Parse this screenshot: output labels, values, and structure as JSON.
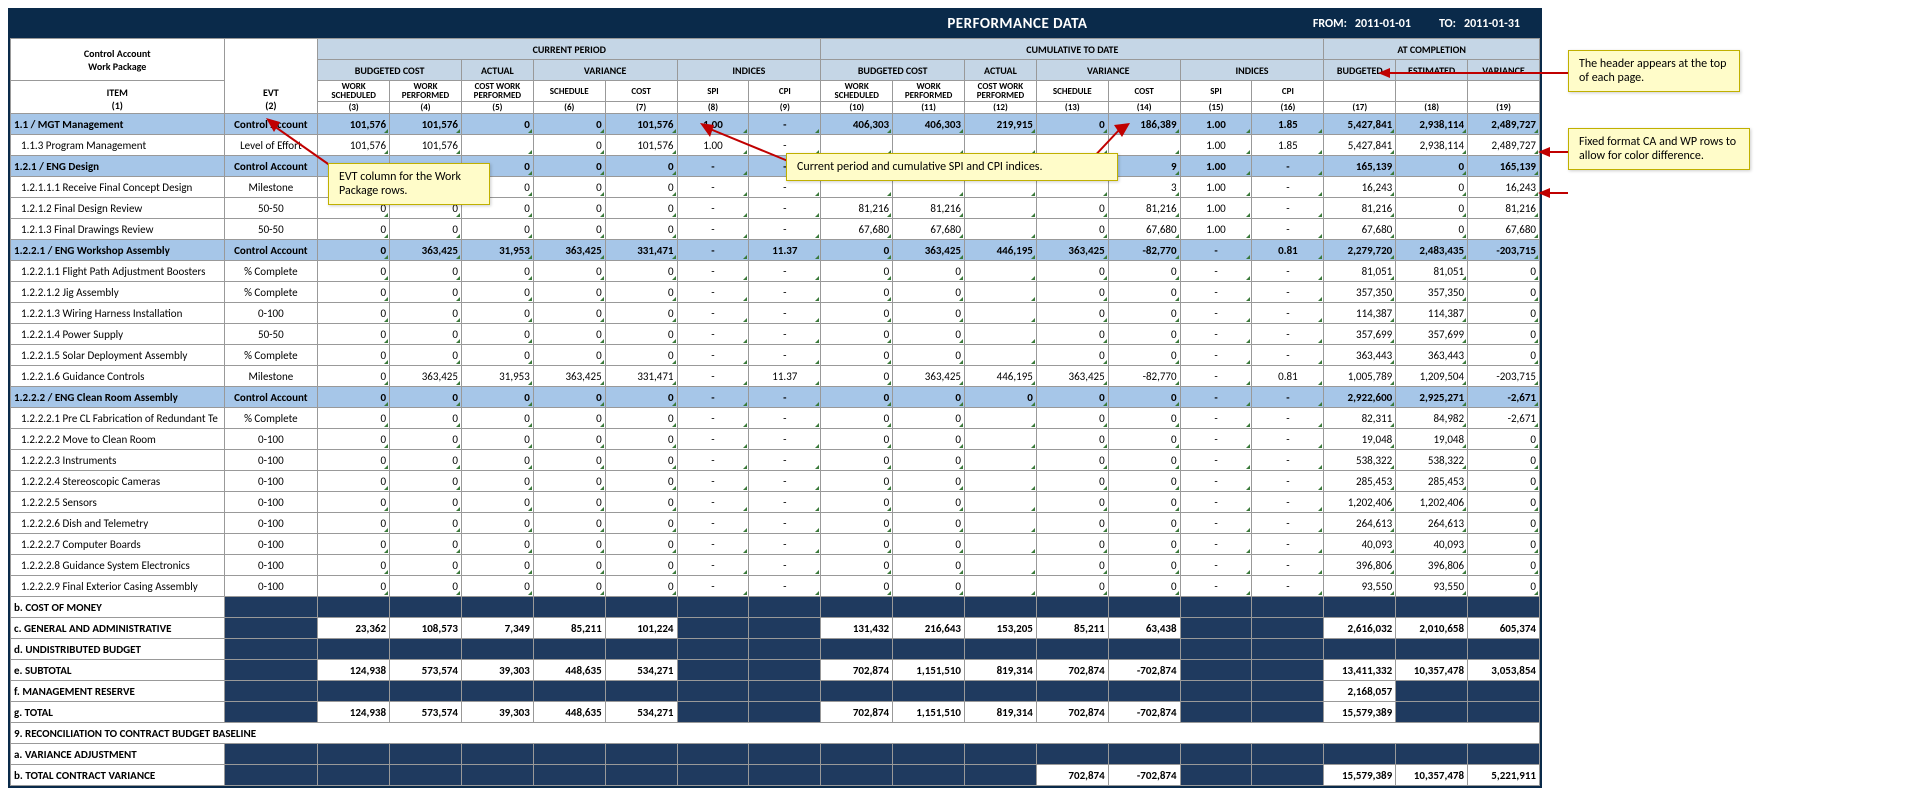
{
  "header": {
    "title": "PERFORMANCE DATA",
    "from_label": "FROM:",
    "from_date": "2011-01-01",
    "to_label": "TO:",
    "to_date": "2011-01-31"
  },
  "col_headers": {
    "ca": "Control Account",
    "wp": "Work Package",
    "item": "ITEM",
    "evt": "EVT",
    "current_period": "CURRENT PERIOD",
    "cumulative": "CUMULATIVE TO DATE",
    "at_completion": "AT COMPLETION",
    "budgeted_cost": "BUDGETED COST",
    "actual": "ACTUAL",
    "variance": "VARIANCE",
    "indices": "INDICES",
    "budgeted": "BUDGETED",
    "estimated": "ESTIMATED",
    "variance2": "VARIANCE",
    "work_scheduled": "WORK SCHEDULED",
    "work_performed": "WORK PERFORMED",
    "cost_work_performed": "COST WORK PERFORMED",
    "schedule": "SCHEDULE",
    "cost": "COST",
    "spi": "SPI",
    "cpi": "CPI",
    "n1": "(1)",
    "n2": "(2)",
    "n3": "(3)",
    "n4": "(4)",
    "n5": "(5)",
    "n6": "(6)",
    "n7": "(7)",
    "n8": "(8)",
    "n9": "(9)",
    "n10": "(10)",
    "n11": "(11)",
    "n12": "(12)",
    "n13": "(13)",
    "n14": "(14)",
    "n15": "(15)",
    "n16": "(16)",
    "n17": "(17)",
    "n18": "(18)",
    "n19": "(19)"
  },
  "rows": [
    {
      "cls": "ca",
      "item": "1.1 / MGT Management",
      "evt": "Control Account",
      "c": [
        "101,576",
        "101,576",
        "0",
        "0",
        "101,576",
        "1.00",
        "-",
        "406,303",
        "406,303",
        "219,915",
        "0",
        "186,389",
        "1.00",
        "1.85",
        "5,427,841",
        "2,938,114",
        "2,489,727"
      ]
    },
    {
      "cls": "wp",
      "item": "1.1.3 Program Management",
      "evt": "Level of Effort",
      "c": [
        "101,576",
        "101,576",
        "",
        "0",
        "101,576",
        "1.00",
        "-",
        "",
        "",
        "",
        "",
        "",
        "1.00",
        "1.85",
        "5,427,841",
        "2,938,114",
        "2,489,727"
      ]
    },
    {
      "cls": "ca",
      "item": "1.2.1 / ENG Design",
      "evt": "Control Account",
      "c": [
        "0",
        "0",
        "0",
        "0",
        "0",
        "-",
        "-",
        "",
        "",
        "",
        "",
        "9",
        "1.00",
        "-",
        "165,139",
        "0",
        "165,139"
      ]
    },
    {
      "cls": "wp",
      "item": "1.2.1.1.1 Receive Final Concept Design",
      "evt": "Milestone",
      "c": [
        "0",
        "",
        "0",
        "0",
        "0",
        "-",
        "-",
        "",
        "",
        "",
        "",
        "3",
        "1.00",
        "-",
        "16,243",
        "0",
        "16,243"
      ]
    },
    {
      "cls": "wp",
      "item": "1.2.1.2 Final Design Review",
      "evt": "50-50",
      "c": [
        "0",
        "0",
        "0",
        "0",
        "0",
        "-",
        "-",
        "81,216",
        "81,216",
        "",
        "0",
        "81,216",
        "1.00",
        "-",
        "81,216",
        "0",
        "81,216"
      ]
    },
    {
      "cls": "wp",
      "item": "1.2.1.3 Final Drawings Review",
      "evt": "50-50",
      "c": [
        "0",
        "0",
        "0",
        "0",
        "0",
        "-",
        "-",
        "67,680",
        "67,680",
        "",
        "0",
        "67,680",
        "1.00",
        "-",
        "67,680",
        "0",
        "67,680"
      ]
    },
    {
      "cls": "ca",
      "item": "1.2.2.1 / ENG Workshop Assembly",
      "evt": "Control Account",
      "c": [
        "0",
        "363,425",
        "31,953",
        "363,425",
        "331,471",
        "-",
        "11.37",
        "0",
        "363,425",
        "446,195",
        "363,425",
        "-82,770",
        "-",
        "0.81",
        "2,279,720",
        "2,483,435",
        "-203,715"
      ]
    },
    {
      "cls": "wp",
      "item": "1.2.2.1.1 Flight Path Adjustment Boosters",
      "evt": "% Complete",
      "c": [
        "0",
        "0",
        "0",
        "0",
        "0",
        "-",
        "-",
        "0",
        "0",
        "",
        "0",
        "0",
        "-",
        "-",
        "81,051",
        "81,051",
        "0"
      ]
    },
    {
      "cls": "wp",
      "item": "1.2.2.1.2 Jig Assembly",
      "evt": "% Complete",
      "c": [
        "0",
        "0",
        "0",
        "0",
        "0",
        "-",
        "-",
        "0",
        "0",
        "",
        "0",
        "0",
        "-",
        "-",
        "357,350",
        "357,350",
        "0"
      ]
    },
    {
      "cls": "wp",
      "item": "1.2.2.1.3 Wiring Harness Installation",
      "evt": "0-100",
      "c": [
        "0",
        "0",
        "0",
        "0",
        "0",
        "-",
        "-",
        "0",
        "0",
        "",
        "0",
        "0",
        "-",
        "-",
        "114,387",
        "114,387",
        "0"
      ]
    },
    {
      "cls": "wp",
      "item": "1.2.2.1.4 Power Supply",
      "evt": "50-50",
      "c": [
        "0",
        "0",
        "0",
        "0",
        "0",
        "-",
        "-",
        "0",
        "0",
        "",
        "0",
        "0",
        "-",
        "-",
        "357,699",
        "357,699",
        "0"
      ]
    },
    {
      "cls": "wp",
      "item": "1.2.2.1.5 Solar Deployment Assembly",
      "evt": "% Complete",
      "c": [
        "0",
        "0",
        "0",
        "0",
        "0",
        "-",
        "-",
        "0",
        "0",
        "",
        "0",
        "0",
        "-",
        "-",
        "363,443",
        "363,443",
        "0"
      ]
    },
    {
      "cls": "wp",
      "item": "1.2.2.1.6 Guidance Controls",
      "evt": "Milestone",
      "c": [
        "0",
        "363,425",
        "31,953",
        "363,425",
        "331,471",
        "-",
        "11.37",
        "0",
        "363,425",
        "446,195",
        "363,425",
        "-82,770",
        "-",
        "0.81",
        "1,005,789",
        "1,209,504",
        "-203,715"
      ]
    },
    {
      "cls": "ca",
      "item": "1.2.2.2 / ENG Clean Room Assembly",
      "evt": "Control Account",
      "c": [
        "0",
        "0",
        "0",
        "0",
        "0",
        "-",
        "-",
        "0",
        "0",
        "0",
        "0",
        "0",
        "-",
        "-",
        "2,922,600",
        "2,925,271",
        "-2,671"
      ]
    },
    {
      "cls": "wp",
      "item": "1.2.2.2.1 Pre CL Fabrication of Redundant Te",
      "evt": "% Complete",
      "c": [
        "0",
        "0",
        "0",
        "0",
        "0",
        "-",
        "-",
        "0",
        "0",
        "",
        "0",
        "0",
        "-",
        "-",
        "82,311",
        "84,982",
        "-2,671"
      ]
    },
    {
      "cls": "wp",
      "item": "1.2.2.2.2 Move to Clean Room",
      "evt": "0-100",
      "c": [
        "0",
        "0",
        "0",
        "0",
        "0",
        "-",
        "-",
        "0",
        "0",
        "",
        "0",
        "0",
        "-",
        "-",
        "19,048",
        "19,048",
        "0"
      ]
    },
    {
      "cls": "wp",
      "item": "1.2.2.2.3 Instruments",
      "evt": "0-100",
      "c": [
        "0",
        "0",
        "0",
        "0",
        "0",
        "-",
        "-",
        "0",
        "0",
        "",
        "0",
        "0",
        "-",
        "-",
        "538,322",
        "538,322",
        "0"
      ]
    },
    {
      "cls": "wp",
      "item": "1.2.2.2.4 Stereoscopic Cameras",
      "evt": "0-100",
      "c": [
        "0",
        "0",
        "0",
        "0",
        "0",
        "-",
        "-",
        "0",
        "0",
        "",
        "0",
        "0",
        "-",
        "-",
        "285,453",
        "285,453",
        "0"
      ]
    },
    {
      "cls": "wp",
      "item": "1.2.2.2.5 Sensors",
      "evt": "0-100",
      "c": [
        "0",
        "0",
        "0",
        "0",
        "0",
        "-",
        "-",
        "0",
        "0",
        "",
        "0",
        "0",
        "-",
        "-",
        "1,202,406",
        "1,202,406",
        "0"
      ]
    },
    {
      "cls": "wp",
      "item": "1.2.2.2.6 Dish and Telemetry",
      "evt": "0-100",
      "c": [
        "0",
        "0",
        "0",
        "0",
        "0",
        "-",
        "-",
        "0",
        "0",
        "",
        "0",
        "0",
        "-",
        "-",
        "264,613",
        "264,613",
        "0"
      ]
    },
    {
      "cls": "wp",
      "item": "1.2.2.2.7 Computer Boards",
      "evt": "0-100",
      "c": [
        "0",
        "0",
        "0",
        "0",
        "0",
        "-",
        "-",
        "0",
        "0",
        "",
        "0",
        "0",
        "-",
        "-",
        "40,093",
        "40,093",
        "0"
      ]
    },
    {
      "cls": "wp",
      "item": "1.2.2.2.8 Guidance System Electronics",
      "evt": "0-100",
      "c": [
        "0",
        "0",
        "0",
        "0",
        "0",
        "-",
        "-",
        "0",
        "0",
        "",
        "0",
        "0",
        "-",
        "-",
        "396,806",
        "396,806",
        "0"
      ]
    },
    {
      "cls": "wp",
      "item": "1.2.2.2.9 Final Exterior Casing Assembly",
      "evt": "0-100",
      "c": [
        "0",
        "0",
        "0",
        "0",
        "0",
        "-",
        "-",
        "0",
        "0",
        "",
        "0",
        "0",
        "-",
        "-",
        "93,550",
        "93,550",
        "0"
      ]
    }
  ],
  "summary": [
    {
      "label": "b. COST OF MONEY",
      "blankcol2": true,
      "c": [
        "",
        "",
        "",
        "",
        "",
        "",
        "",
        "",
        "",
        "",
        "",
        "",
        "",
        "",
        "",
        "",
        ""
      ]
    },
    {
      "label": "c. GENERAL AND ADMINISTRATIVE",
      "blankcol2": true,
      "c": [
        "23,362",
        "108,573",
        "7,349",
        "85,211",
        "101,224",
        "",
        "",
        "131,432",
        "216,643",
        "153,205",
        "85,211",
        "63,438",
        "",
        "",
        "2,616,032",
        "2,010,658",
        "605,374"
      ]
    },
    {
      "label": "d. UNDISTRIBUTED BUDGET",
      "blankcol2": true,
      "c": [
        "",
        "",
        "",
        "",
        "",
        "",
        "",
        "",
        "",
        "",
        "",
        "",
        "",
        "",
        "",
        "",
        ""
      ]
    },
    {
      "label": "e. SUBTOTAL",
      "blankcol2": true,
      "c": [
        "124,938",
        "573,574",
        "39,303",
        "448,635",
        "534,271",
        "",
        "",
        "702,874",
        "1,151,510",
        "819,314",
        "702,874",
        "-702,874",
        "",
        "",
        "13,411,332",
        "10,357,478",
        "3,053,854"
      ]
    },
    {
      "label": "f. MANAGEMENT RESERVE",
      "blankcol2": true,
      "c": [
        "",
        "",
        "",
        "",
        "",
        "",
        "",
        "",
        "",
        "",
        "",
        "",
        "",
        "",
        "2,168,057",
        "",
        ""
      ]
    },
    {
      "label": "g. TOTAL",
      "blankcol2": true,
      "c": [
        "124,938",
        "573,574",
        "39,303",
        "448,635",
        "534,271",
        "",
        "",
        "702,874",
        "1,151,510",
        "819,314",
        "702,874",
        "-702,874",
        "",
        "",
        "15,579,389",
        "",
        ""
      ]
    },
    {
      "label": "9. RECONCILIATION TO CONTRACT BUDGET BASELINE",
      "span": true
    },
    {
      "label": "a. VARIANCE ADJUSTMENT",
      "blankcol2": true,
      "c": [
        "",
        "",
        "",
        "",
        "",
        "",
        "",
        "",
        "",
        "",
        "",
        "",
        "",
        "",
        "",
        "",
        ""
      ]
    },
    {
      "label": "b. TOTAL CONTRACT VARIANCE",
      "blankcol2": true,
      "c": [
        "",
        "",
        "",
        "",
        "",
        "",
        "",
        "",
        "",
        "",
        "702,874",
        "-702,874",
        "",
        "",
        "15,579,389",
        "10,357,478",
        "5,221,911"
      ]
    }
  ],
  "callouts": {
    "c1": "The header appears at the top of each page.",
    "c2": "Fixed format CA and WP rows to allow for color difference.",
    "c3": "EVT column for the Work Package rows.",
    "c4": "Current period and cumulative SPI and CPI indices."
  }
}
